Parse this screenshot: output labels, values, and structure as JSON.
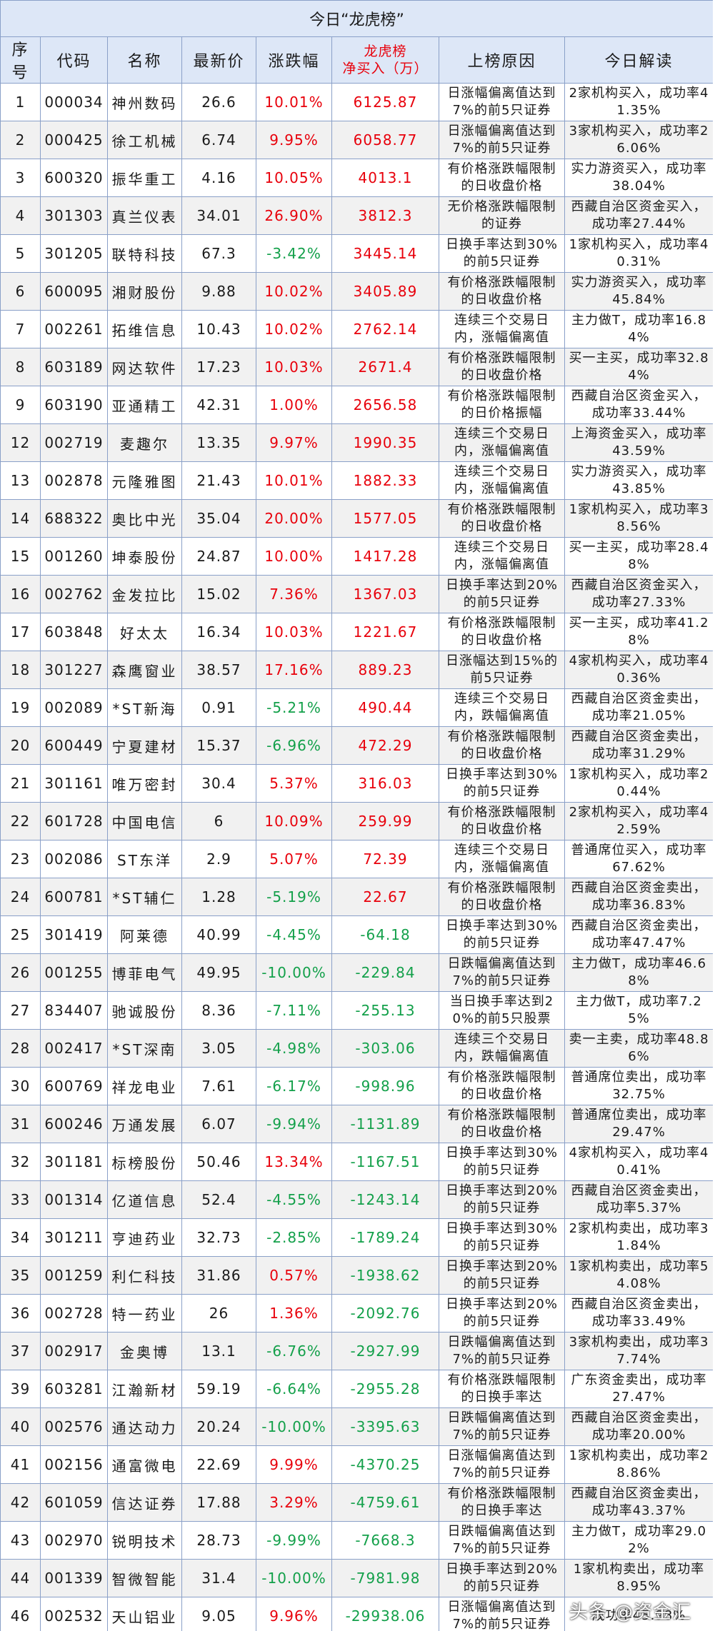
{
  "title": "今日“龙虎榜”",
  "headers": [
    "序号",
    "代码",
    "名称",
    "最新价",
    "涨跌幅",
    "龙虎榜\n净买入（万）",
    "上榜原因",
    "今日解读"
  ],
  "rows": [
    {
      "idx": "1",
      "code": "000034",
      "name": "神州数码",
      "price": "26.6",
      "chg": "10.01%",
      "net": "6125.87",
      "reason": "日涨幅偏离值达到7%的前5只证券",
      "note": "2家机构买入，成功率41.35%"
    },
    {
      "idx": "2",
      "code": "000425",
      "name": "徐工机械",
      "price": "6.74",
      "chg": "9.95%",
      "net": "6058.77",
      "reason": "日涨幅偏离值达到7%的前5只证券",
      "note": "3家机构买入，成功率26.06%"
    },
    {
      "idx": "3",
      "code": "600320",
      "name": "振华重工",
      "price": "4.16",
      "chg": "10.05%",
      "net": "4013.1",
      "reason": "有价格涨跌幅限制的日收盘价格",
      "note": "实力游资买入，成功率38.04%"
    },
    {
      "idx": "4",
      "code": "301303",
      "name": "真兰仪表",
      "price": "34.01",
      "chg": "26.90%",
      "net": "3812.3",
      "reason": "无价格涨跌幅限制的证券",
      "note": "西藏自治区资金买入，成功率27.44%"
    },
    {
      "idx": "5",
      "code": "301205",
      "name": "联特科技",
      "price": "67.3",
      "chg": "-3.42%",
      "net": "3445.14",
      "reason": "日换手率达到30%的前5只证券",
      "note": "1家机构买入，成功率40.31%"
    },
    {
      "idx": "6",
      "code": "600095",
      "name": "湘财股份",
      "price": "9.88",
      "chg": "10.02%",
      "net": "3405.89",
      "reason": "有价格涨跌幅限制的日收盘价格",
      "note": "实力游资买入，成功率45.84%"
    },
    {
      "idx": "7",
      "code": "002261",
      "name": "拓维信息",
      "price": "10.43",
      "chg": "10.02%",
      "net": "2762.14",
      "reason": "连续三个交易日内，涨幅偏离值",
      "note": "主力做T，成功率16.84%"
    },
    {
      "idx": "8",
      "code": "603189",
      "name": "网达软件",
      "price": "17.23",
      "chg": "10.03%",
      "net": "2671.4",
      "reason": "有价格涨跌幅限制的日收盘价格",
      "note": "买一主买，成功率32.84%"
    },
    {
      "idx": "9",
      "code": "603190",
      "name": "亚通精工",
      "price": "42.31",
      "chg": "1.00%",
      "net": "2656.58",
      "reason": "有价格涨跌幅限制的日价格振幅",
      "note": "西藏自治区资金买入，成功率33.44%"
    },
    {
      "idx": "12",
      "code": "002719",
      "name": "麦趣尔",
      "price": "13.35",
      "chg": "9.97%",
      "net": "1990.35",
      "reason": "连续三个交易日内，涨幅偏离值",
      "note": "上海资金买入，成功率43.59%"
    },
    {
      "idx": "13",
      "code": "002878",
      "name": "元隆雅图",
      "price": "21.43",
      "chg": "10.01%",
      "net": "1882.33",
      "reason": "连续三个交易日内，涨幅偏离值",
      "note": "实力游资买入，成功率43.85%"
    },
    {
      "idx": "14",
      "code": "688322",
      "name": "奥比中光",
      "price": "35.04",
      "chg": "20.00%",
      "net": "1577.05",
      "reason": "有价格涨跌幅限制的日收盘价格",
      "note": "1家机构买入，成功率38.56%"
    },
    {
      "idx": "15",
      "code": "001260",
      "name": "坤泰股份",
      "price": "24.87",
      "chg": "10.00%",
      "net": "1417.28",
      "reason": "连续三个交易日内，涨幅偏离值",
      "note": "买一主买，成功率28.48%"
    },
    {
      "idx": "16",
      "code": "002762",
      "name": "金发拉比",
      "price": "15.02",
      "chg": "7.36%",
      "net": "1367.03",
      "reason": "日换手率达到20%的前5只证券",
      "note": "西藏自治区资金买入，成功率27.33%"
    },
    {
      "idx": "17",
      "code": "603848",
      "name": "好太太",
      "price": "16.34",
      "chg": "10.03%",
      "net": "1221.67",
      "reason": "有价格涨跌幅限制的日收盘价格",
      "note": "买一主买，成功率41.28%"
    },
    {
      "idx": "18",
      "code": "301227",
      "name": "森鹰窗业",
      "price": "38.57",
      "chg": "17.16%",
      "net": "889.23",
      "reason": "日涨幅达到15%的前5只证券",
      "note": "4家机构买入，成功率40.36%"
    },
    {
      "idx": "19",
      "code": "002089",
      "name": "*ST新海",
      "price": "0.91",
      "chg": "-5.21%",
      "net": "490.44",
      "reason": "连续三个交易日内，跌幅偏离值",
      "note": "西藏自治区资金卖出，成功率21.05%"
    },
    {
      "idx": "20",
      "code": "600449",
      "name": "宁夏建材",
      "price": "15.37",
      "chg": "-6.96%",
      "net": "472.29",
      "reason": "有价格涨跌幅限制的日收盘价格",
      "note": "西藏自治区资金卖出，成功率31.29%"
    },
    {
      "idx": "21",
      "code": "301161",
      "name": "唯万密封",
      "price": "30.4",
      "chg": "5.37%",
      "net": "316.03",
      "reason": "日换手率达到30%的前5只证券",
      "note": "1家机构买入，成功率20.44%"
    },
    {
      "idx": "22",
      "code": "601728",
      "name": "中国电信",
      "price": "6",
      "chg": "10.09%",
      "net": "259.99",
      "reason": "有价格涨跌幅限制的日收盘价格",
      "note": "2家机构买入，成功率42.59%"
    },
    {
      "idx": "23",
      "code": "002086",
      "name": "ST东洋",
      "price": "2.9",
      "chg": "5.07%",
      "net": "72.39",
      "reason": "连续三个交易日内，涨幅偏离值",
      "note": "普通席位买入，成功率67.62%"
    },
    {
      "idx": "24",
      "code": "600781",
      "name": "*ST辅仁",
      "price": "1.28",
      "chg": "-5.19%",
      "net": "22.67",
      "reason": "有价格涨跌幅限制的日收盘价格",
      "note": "西藏自治区资金卖出，成功率36.83%"
    },
    {
      "idx": "25",
      "code": "301419",
      "name": "阿莱德",
      "price": "40.99",
      "chg": "-4.45%",
      "net": "-64.18",
      "reason": "日换手率达到30%的前5只证券",
      "note": "西藏自治区资金卖出，成功率47.47%"
    },
    {
      "idx": "26",
      "code": "001255",
      "name": "博菲电气",
      "price": "49.95",
      "chg": "-10.00%",
      "net": "-229.84",
      "reason": "日跌幅偏离值达到7%的前5只证券",
      "note": "主力做T，成功率46.68%"
    },
    {
      "idx": "27",
      "code": "834407",
      "name": "驰诚股份",
      "price": "8.36",
      "chg": "-7.11%",
      "net": "-255.13",
      "reason": "当日换手率达到20%的前5只股票",
      "note": "主力做T，成功率7.25%"
    },
    {
      "idx": "28",
      "code": "002417",
      "name": "*ST深南",
      "price": "3.05",
      "chg": "-4.98%",
      "net": "-303.06",
      "reason": "连续三个交易日内，跌幅偏离值",
      "note": "卖一主卖，成功率48.86%"
    },
    {
      "idx": "30",
      "code": "600769",
      "name": "祥龙电业",
      "price": "7.61",
      "chg": "-6.17%",
      "net": "-998.96",
      "reason": "有价格涨跌幅限制的日收盘价格",
      "note": "普通席位卖出，成功率32.75%"
    },
    {
      "idx": "31",
      "code": "600246",
      "name": "万通发展",
      "price": "6.07",
      "chg": "-9.94%",
      "net": "-1131.89",
      "reason": "有价格涨跌幅限制的日收盘价格",
      "note": "普通席位卖出，成功率29.47%"
    },
    {
      "idx": "32",
      "code": "301181",
      "name": "标榜股份",
      "price": "50.46",
      "chg": "13.34%",
      "net": "-1167.51",
      "reason": "日换手率达到30%的前5只证券",
      "note": "4家机构买入，成功率40.41%"
    },
    {
      "idx": "33",
      "code": "001314",
      "name": "亿道信息",
      "price": "52.4",
      "chg": "-4.55%",
      "net": "-1243.14",
      "reason": "日换手率达到20%的前5只证券",
      "note": "西藏自治区资金卖出，成功率5.37%"
    },
    {
      "idx": "34",
      "code": "301211",
      "name": "亨迪药业",
      "price": "32.73",
      "chg": "-2.85%",
      "net": "-1789.24",
      "reason": "日换手率达到30%的前5只证券",
      "note": "2家机构卖出，成功率31.84%"
    },
    {
      "idx": "35",
      "code": "001259",
      "name": "利仁科技",
      "price": "31.86",
      "chg": "0.57%",
      "net": "-1938.62",
      "reason": "日换手率达到20%的前5只证券",
      "note": "1家机构卖出，成功率54.08%"
    },
    {
      "idx": "36",
      "code": "002728",
      "name": "特一药业",
      "price": "26",
      "chg": "1.36%",
      "net": "-2092.76",
      "reason": "日换手率达到20%的前5只证券",
      "note": "西藏自治区资金卖出，成功率33.49%"
    },
    {
      "idx": "37",
      "code": "002917",
      "name": "金奥博",
      "price": "13.1",
      "chg": "-6.76%",
      "net": "-2927.99",
      "reason": "日跌幅偏离值达到7%的前5只证券",
      "note": "3家机构卖出，成功率37.74%"
    },
    {
      "idx": "39",
      "code": "603281",
      "name": "江瀚新材",
      "price": "59.19",
      "chg": "-6.64%",
      "net": "-2955.28",
      "reason": "有价格涨跌幅限制的日换手率达",
      "note": "广东资金卖出，成功率27.47%"
    },
    {
      "idx": "40",
      "code": "002576",
      "name": "通达动力",
      "price": "20.24",
      "chg": "-10.00%",
      "net": "-3395.63",
      "reason": "日跌幅偏离值达到7%的前5只证券",
      "note": "西藏自治区资金卖出，成功率20.00%"
    },
    {
      "idx": "41",
      "code": "002156",
      "name": "通富微电",
      "price": "22.69",
      "chg": "9.99%",
      "net": "-4370.25",
      "reason": "日涨幅偏离值达到7%的前5只证券",
      "note": "1家机构卖出，成功率28.86%"
    },
    {
      "idx": "42",
      "code": "601059",
      "name": "信达证券",
      "price": "17.88",
      "chg": "3.29%",
      "net": "-4759.61",
      "reason": "有价格涨跌幅限制的日换手率达",
      "note": "西藏自治区资金卖出，成功率43.37%"
    },
    {
      "idx": "43",
      "code": "002970",
      "name": "锐明技术",
      "price": "28.73",
      "chg": "-9.99%",
      "net": "-7668.3",
      "reason": "日跌幅偏离值达到7%的前5只证券",
      "note": "主力做T，成功率29.02%"
    },
    {
      "idx": "44",
      "code": "001339",
      "name": "智微智能",
      "price": "31.4",
      "chg": "-10.00%",
      "net": "-7981.98",
      "reason": "日换手率达到20%的前5只证券",
      "note": "1家机构卖出，成功率8.95%"
    },
    {
      "idx": "46",
      "code": "002532",
      "name": "天山铝业",
      "price": "9.05",
      "chg": "9.96%",
      "net": "-29938.06",
      "reason": "日涨幅偏离值达到7%的前5只证券",
      "note": "成功率45.98%"
    }
  ],
  "watermark": "头条 @资金汇",
  "colors": {
    "up": "#e8000b",
    "down": "#13a04a",
    "header_bg": "#dde7f7",
    "border": "#8aa0c8"
  }
}
